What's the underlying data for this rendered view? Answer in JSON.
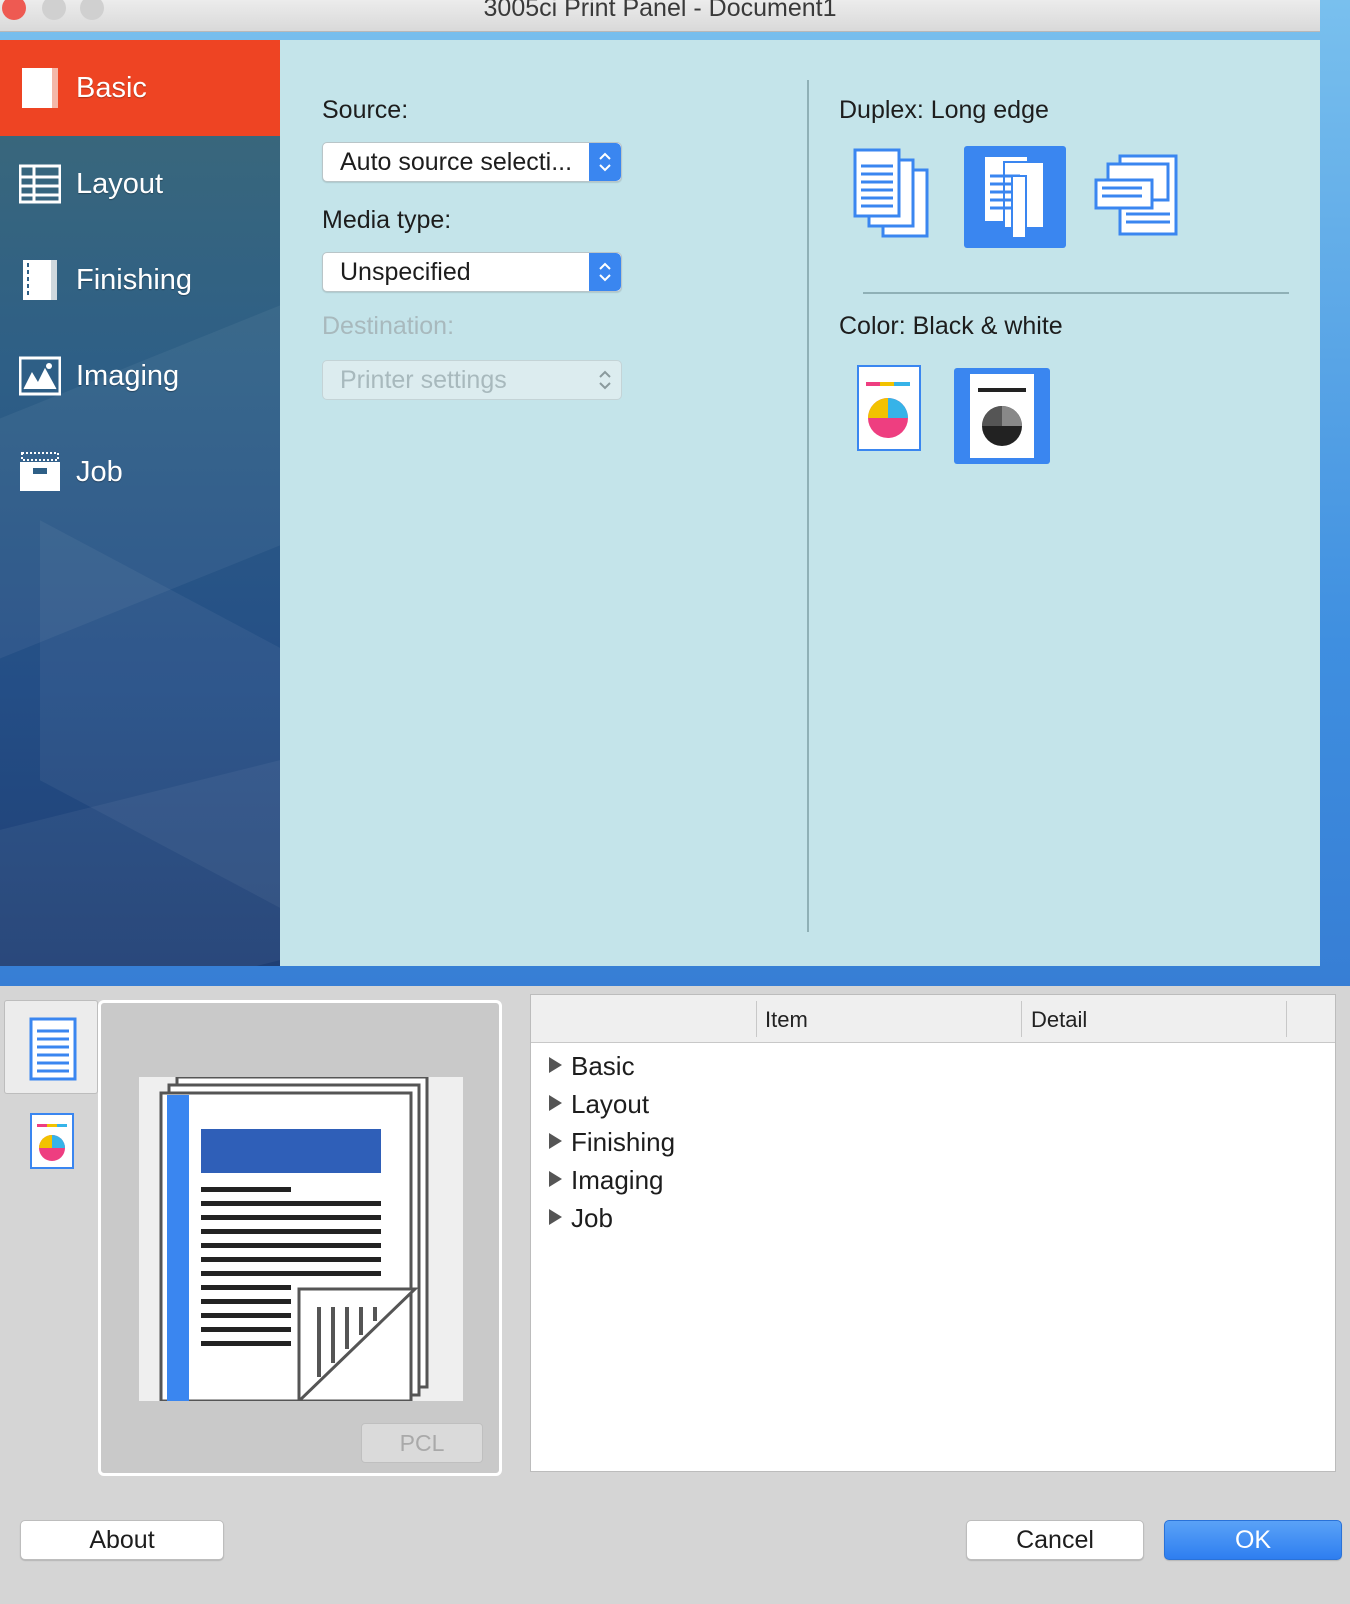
{
  "window": {
    "title": "3005ci Print Panel - Document1"
  },
  "sidebar": {
    "items": [
      {
        "label": "Basic",
        "icon": "basic-page-icon",
        "active": true
      },
      {
        "label": "Layout",
        "icon": "layout-grid-icon",
        "active": false
      },
      {
        "label": "Finishing",
        "icon": "finishing-page-icon",
        "active": false
      },
      {
        "label": "Imaging",
        "icon": "imaging-picture-icon",
        "active": false
      },
      {
        "label": "Job",
        "icon": "job-box-icon",
        "active": false
      }
    ]
  },
  "basic": {
    "source": {
      "label": "Source:",
      "value": "Auto source selecti..."
    },
    "media_type": {
      "label": "Media type:",
      "value": "Unspecified"
    },
    "destination": {
      "label": "Destination:",
      "value": "Printer settings",
      "disabled": true
    },
    "duplex": {
      "label": "Duplex: Long edge",
      "options": [
        "simplex-icon",
        "duplex-long-edge-icon",
        "duplex-short-edge-icon"
      ],
      "selected": 1
    },
    "color": {
      "label": "Color: Black & white",
      "options": [
        "color-pie-icon",
        "black-white-pie-icon"
      ],
      "selected": 1
    }
  },
  "preview": {
    "tabs": [
      "document-preview-icon",
      "color-preview-icon"
    ],
    "pdl_button": "PCL"
  },
  "summary": {
    "columns": [
      "Item",
      "Detail"
    ],
    "rows": [
      "Basic",
      "Layout",
      "Finishing",
      "Imaging",
      "Job"
    ]
  },
  "buttons": {
    "about": "About",
    "cancel": "Cancel",
    "ok": "OK"
  },
  "colors": {
    "accent_red": "#ee4423",
    "accent_blue": "#3a86f0",
    "panel_bg": "#c4e4ea"
  }
}
